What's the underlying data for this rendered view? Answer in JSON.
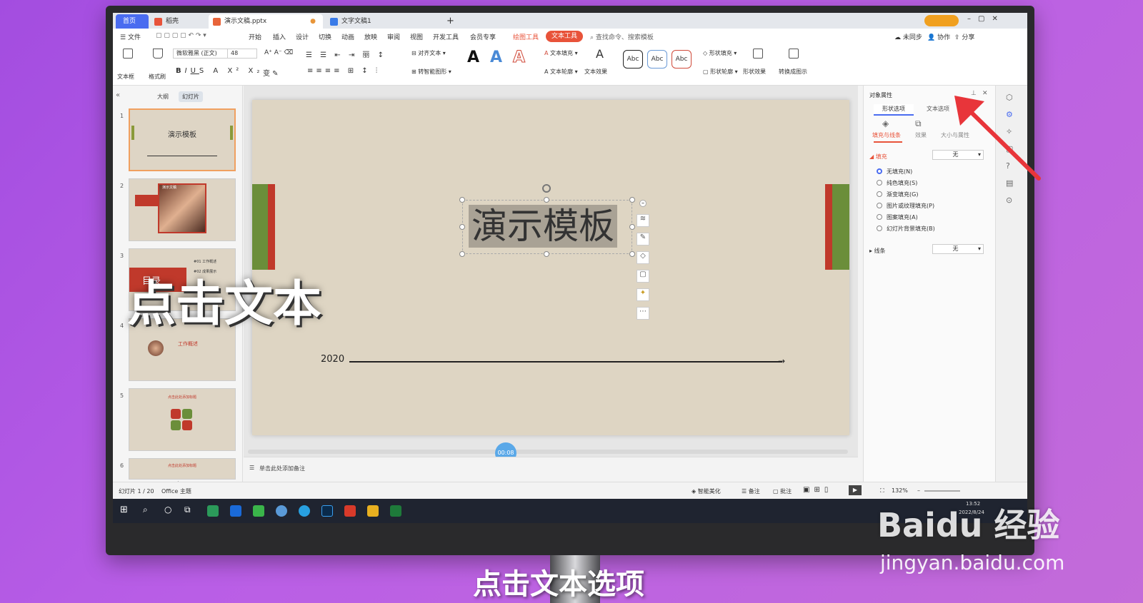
{
  "tabs": {
    "home": "首页",
    "daoke": "稻壳",
    "doc": "演示文稿.pptx",
    "doc2": "文字文稿1"
  },
  "menu": {
    "file": "文件",
    "items": [
      "开始",
      "插入",
      "设计",
      "切换",
      "动画",
      "放映",
      "审阅",
      "视图",
      "开发工具",
      "会员专享"
    ],
    "drawing_tools": "绘图工具",
    "text_tools": "文本工具",
    "search": "查找命令、搜索模板",
    "sync": "未同步",
    "collab": "协作",
    "share": "分享"
  },
  "toolbar": {
    "textbox": "文本框",
    "format_painter": "格式刷",
    "font_name": "微软雅黑 (正文)",
    "font_size": "48",
    "align_text": "对齐文本",
    "smart_shape": "转智能图形",
    "text_fill": "文本填充",
    "text_outline": "文本轮廓",
    "text_effect": "文本效果",
    "abc": "Abc",
    "shape_fill": "形状填充",
    "shape_outline": "形状轮廓",
    "shape_effect": "形状效果",
    "convert_diagram": "转换成图示"
  },
  "leftpanel": {
    "outline": "大纲",
    "slides": "幻灯片",
    "slide1_title": "演示模板",
    "slide2_title": "演示文稿",
    "slide3_title": "目录",
    "slide3_items": [
      "#01 工作概述",
      "#02 成果展示"
    ],
    "slide4_title": "工作概述",
    "slide5_title": "点击此处添加标题",
    "slide6_title": "点击此处添加标题",
    "nums": [
      "1",
      "2",
      "3",
      "4",
      "5",
      "6"
    ]
  },
  "slide": {
    "title": "演示模板",
    "year": "2020"
  },
  "notes": "单击此处添加备注",
  "timer": "00:08",
  "status": {
    "slide_count": "幻灯片 1 / 20",
    "theme": "Office 主题",
    "beautify": "智能美化",
    "notes": "备注",
    "comment": "批注",
    "zoom": "132%"
  },
  "rightpanel": {
    "title": "对象属性",
    "tab_shape": "形状选项",
    "tab_text": "文本选项",
    "sub_fill": "填充与线条",
    "sub_effect": "效果",
    "sub_size": "大小与属性",
    "fill_label": "填充",
    "fill_value": "无",
    "options": [
      "无填充(N)",
      "纯色填充(S)",
      "渐变填充(G)",
      "图片或纹理填充(P)",
      "图案填充(A)",
      "幻灯片背景填充(B)"
    ],
    "line_label": "线条",
    "line_value": "无"
  },
  "taskbar": {
    "time": "13:52",
    "date": "2022/8/24"
  },
  "overlays": {
    "click_text": "点击文本",
    "caption": "点击文本选项"
  },
  "watermark": {
    "logo": "Baidu 经验",
    "url": "jingyan.baidu.com"
  },
  "colors": {
    "accent_red": "#c0392b",
    "accent_green": "#6b8e3a",
    "wps_orange": "#e8533a",
    "slide_bg": "#ded5c3"
  }
}
